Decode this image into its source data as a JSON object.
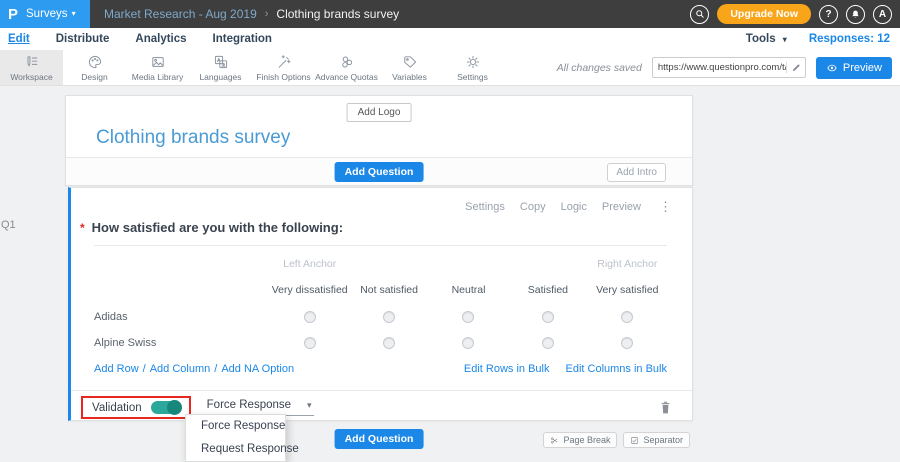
{
  "header": {
    "logo": "P",
    "product": "Surveys",
    "caret": "▾",
    "breadcrumb": {
      "parent": "Market Research - Aug 2019",
      "separator": "›",
      "current": "Clothing brands survey"
    },
    "upgrade_label": "Upgrade Now",
    "help_label": "?",
    "avatar_label": "A"
  },
  "nav": {
    "items": [
      {
        "label": "Edit"
      },
      {
        "label": "Distribute"
      },
      {
        "label": "Analytics"
      },
      {
        "label": "Integration"
      }
    ],
    "tools_label": "Tools",
    "responses_label": "Responses: 12"
  },
  "toolbar": {
    "items": [
      {
        "label": "Workspace"
      },
      {
        "label": "Design"
      },
      {
        "label": "Media Library"
      },
      {
        "label": "Languages"
      },
      {
        "label": "Finish Options"
      },
      {
        "label": "Advance Quotas"
      },
      {
        "label": "Variables"
      },
      {
        "label": "Settings"
      }
    ],
    "save_status": "All changes saved",
    "share_url": "https://www.questionpro.com/t/APNrFZ",
    "preview_label": "Preview"
  },
  "survey": {
    "add_logo_label": "Add Logo",
    "title": "Clothing brands survey",
    "add_question_label": "Add Question",
    "add_intro_label": "Add Intro"
  },
  "question": {
    "id_label": "Q1",
    "actions": [
      "Settings",
      "Copy",
      "Logic",
      "Preview"
    ],
    "kebab": "⋮",
    "required_marker": "*",
    "text": "How satisfied are you with the following:",
    "matrix": {
      "left_anchor_label": "Left Anchor",
      "right_anchor_label": "Right Anchor",
      "columns": [
        "Very dissatisfied",
        "Not satisfied",
        "Neutral",
        "Satisfied",
        "Very satisfied"
      ],
      "rows": [
        "Adidas",
        "Alpine Swiss"
      ]
    },
    "row_links": [
      "Add Row",
      "Add Column",
      "Add NA Option"
    ],
    "links_separator": "/",
    "bulk_links": [
      "Edit Rows in Bulk",
      "Edit Columns in Bulk"
    ],
    "validation": {
      "label": "Validation",
      "selected_option": "Force Response",
      "caret": "▾"
    },
    "dropdown_options": [
      "Force Response",
      "Request Response"
    ]
  },
  "footer": {
    "add_question_label": "Add Question",
    "page_break_label": "Page Break",
    "separator_label": "Separator"
  },
  "colors": {
    "accent_blue": "#1b87e6",
    "logo_blue": "#2d9bf0",
    "upgrade_orange": "#f9a51a",
    "toggle_teal": "#2ba79b",
    "alert_red": "#e8271e",
    "header_dark": "#3e3e3e"
  }
}
